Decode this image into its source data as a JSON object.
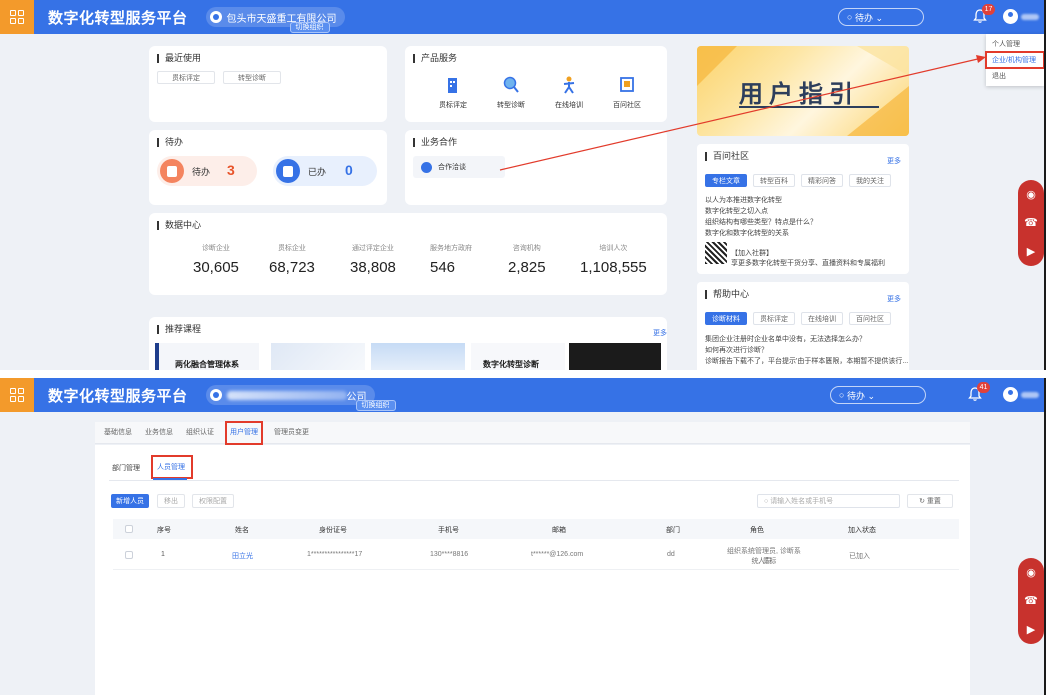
{
  "header": {
    "brand": "数字化转型服务平台",
    "company": "包头市天盛重工有限公司",
    "company_second": "公司",
    "switch_label": "切换组织",
    "search_label": "待办 ⌄",
    "bell_badge_1": "17",
    "bell_badge_2": "41"
  },
  "user_menu": {
    "items": [
      "个人管理",
      "企业/机构管理",
      "退出"
    ]
  },
  "recent": {
    "title": "最近使用",
    "items": [
      "贯标评定",
      "转型诊断"
    ]
  },
  "products": {
    "title": "产品服务",
    "items": [
      "贯标评定",
      "转型诊断",
      "在线培训",
      "百问社区"
    ]
  },
  "todo": {
    "title": "待办",
    "pending_label": "待办",
    "pending_count": "3",
    "done_label": "已办",
    "done_count": "0"
  },
  "cooperation": {
    "title": "业务合作",
    "item": "合作洽谈"
  },
  "data_center": {
    "title": "数据中心",
    "stats": [
      {
        "label": "诊断企业",
        "value": "30,605"
      },
      {
        "label": "贯标企业",
        "value": "68,723"
      },
      {
        "label": "通过评定企业",
        "value": "38,808"
      },
      {
        "label": "服务地方政府",
        "value": "546"
      },
      {
        "label": "咨询机构",
        "value": "2,825"
      },
      {
        "label": "培训人次",
        "value": "1,108,555"
      }
    ]
  },
  "courses": {
    "title": "推荐课程",
    "more": "更多",
    "thumbs": [
      "两化融合管理体系",
      "数字化转型诊断"
    ]
  },
  "guide": {
    "banner_text": "用户指引"
  },
  "community": {
    "title": "百问社区",
    "more": "更多",
    "tabs": [
      "专栏文章",
      "转型百科",
      "精彩问答",
      "我的关注"
    ],
    "lines": [
      "以人为本推进数字化转型",
      "数字化转型之切入点",
      "组织结构有哪些类型？特点是什么？",
      "数字化和数字化转型的关系"
    ],
    "join_title": "【加入社群】",
    "join_desc": "享更多数字化转型干货分享、直播资料和专属福利"
  },
  "help": {
    "title": "帮助中心",
    "more": "更多",
    "tabs": [
      "诊断材料",
      "贯标评定",
      "在线培训",
      "百问社区"
    ],
    "lines": [
      "集团企业注册时企业名单中没有，无法选择怎么办？",
      "如何再次进行诊断？",
      "诊断报告下载不了，平台提示'由于样本匮限，本期暂不提供该行..."
    ]
  },
  "org_page": {
    "top_tabs": [
      "基础信息",
      "业务信息",
      "组织认证",
      "用户管理",
      "管理员变更"
    ],
    "sub_tabs": [
      "部门管理",
      "人员管理"
    ],
    "actions": [
      "新增人员",
      "移出",
      "权限配置"
    ],
    "search_placeholder": "请输入姓名或手机号",
    "reset_label": "↻ 重置",
    "columns": [
      "序号",
      "姓名",
      "身份证号",
      "手机号",
      "邮箱",
      "部门",
      "角色",
      "加入状态"
    ],
    "rows": [
      {
        "index": "1",
        "name": "田立光",
        "id_no": "1****************17",
        "phone": "130****8816",
        "email": "t******@126.com",
        "dept": "dd",
        "role_line1": "组织系统管理员, 诊断系统, 贯标",
        "role_line2": "人员",
        "status": "已加入"
      }
    ]
  }
}
